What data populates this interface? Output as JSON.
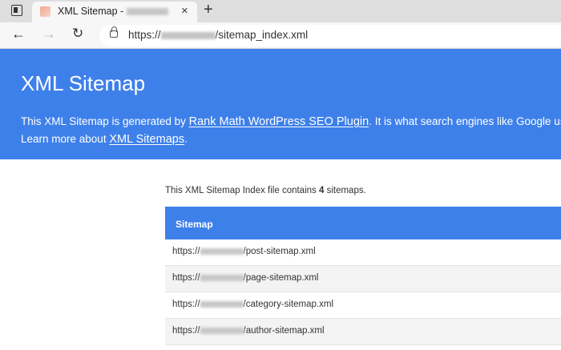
{
  "browser": {
    "tab_title": "XML Sitemap -",
    "tab_close": "×",
    "new_tab": "+",
    "back": "←",
    "forward": "→",
    "reload": "↻",
    "url_prefix": "https://",
    "url_path": "/sitemap_index.xml"
  },
  "hero": {
    "title": "XML Sitemap",
    "desc_part1": "This XML Sitemap is generated by ",
    "plugin_link": "Rank Math WordPress SEO Plugin",
    "desc_part2": ". It is what search engines like Google use to",
    "desc_part3": "Learn more about ",
    "sitemaps_link": "XML Sitemaps",
    "desc_part4": "."
  },
  "summary": {
    "prefix": "This XML Sitemap Index file contains ",
    "count": "4",
    "suffix": " sitemaps."
  },
  "table": {
    "header": "Sitemap",
    "rows": [
      {
        "prefix": "https://",
        "path": "/post-sitemap.xml"
      },
      {
        "prefix": "https://",
        "path": "/page-sitemap.xml"
      },
      {
        "prefix": "https://",
        "path": "/category-sitemap.xml"
      },
      {
        "prefix": "https://",
        "path": "/author-sitemap.xml"
      }
    ]
  },
  "colors": {
    "accent": "#3e80ea",
    "row_alt": "#f3f3f3"
  }
}
